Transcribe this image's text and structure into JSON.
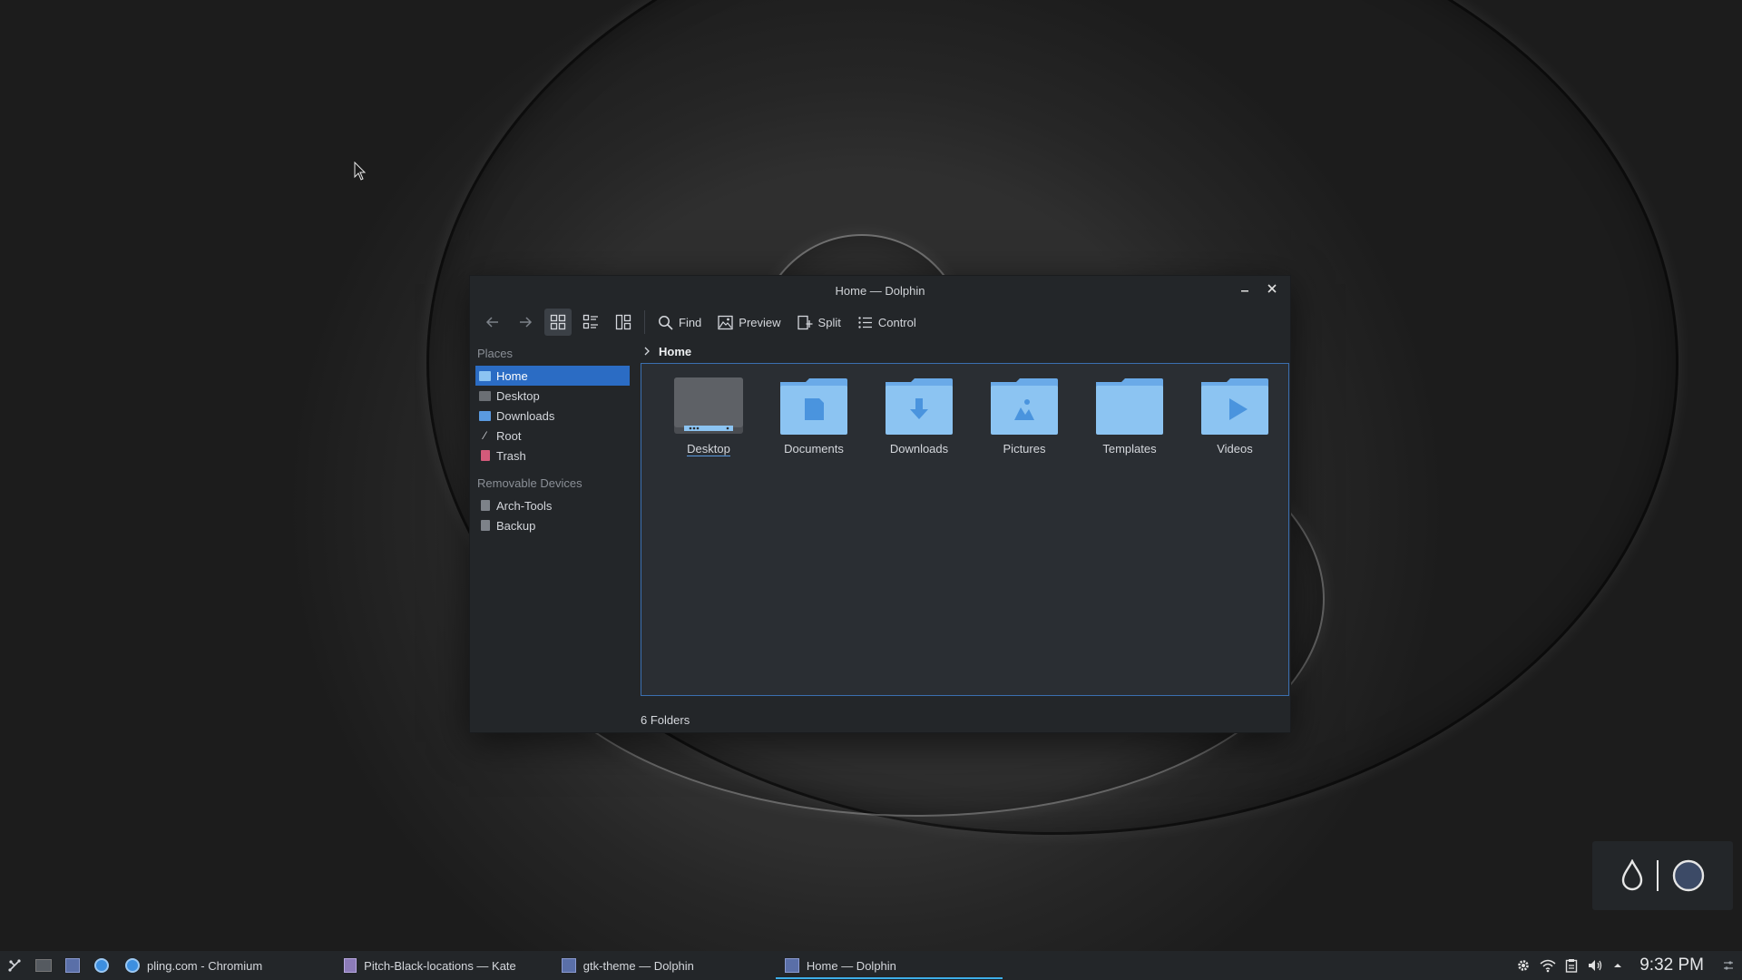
{
  "window": {
    "title": "Home — Dolphin",
    "minimize_symbol": "–",
    "close_symbol": "✕"
  },
  "toolbar": {
    "back_icon": "arrow-left-icon",
    "forward_icon": "arrow-right-icon",
    "view_modes": [
      "icons-view",
      "compact-view",
      "details-view"
    ],
    "find_label": "Find",
    "preview_label": "Preview",
    "split_label": "Split",
    "control_label": "Control"
  },
  "places": {
    "title": "Places",
    "items": [
      {
        "label": "Home",
        "icon": "home-icon",
        "color": "#5a9ae0",
        "selected": true
      },
      {
        "label": "Desktop",
        "icon": "desktop-icon",
        "color": "#8b8f94"
      },
      {
        "label": "Downloads",
        "icon": "downloads-icon",
        "color": "#5a9ae0"
      },
      {
        "label": "Root",
        "icon": "root-icon",
        "color": "#d4d7dc"
      },
      {
        "label": "Trash",
        "icon": "trash-icon",
        "color": "#d35a7a"
      }
    ]
  },
  "removable": {
    "title": "Removable Devices",
    "items": [
      {
        "label": "Arch-Tools",
        "icon": "drive-icon"
      },
      {
        "label": "Backup",
        "icon": "drive-icon"
      }
    ]
  },
  "breadcrumb": {
    "current": "Home"
  },
  "files": [
    {
      "label": "Desktop",
      "icon": "desktop-folder-icon"
    },
    {
      "label": "Documents",
      "icon": "documents-folder-icon"
    },
    {
      "label": "Downloads",
      "icon": "downloads-folder-icon"
    },
    {
      "label": "Pictures",
      "icon": "pictures-folder-icon"
    },
    {
      "label": "Templates",
      "icon": "templates-folder-icon"
    },
    {
      "label": "Videos",
      "icon": "videos-folder-icon"
    }
  ],
  "status": {
    "text": "6 Folders"
  },
  "taskbar": {
    "tasks": [
      {
        "label": "pling.com - Chromium",
        "icon": "chromium-icon"
      },
      {
        "label": "Pitch-Black-locations — Kate",
        "icon": "kate-icon"
      },
      {
        "label": "gtk-theme — Dolphin",
        "icon": "dolphin-icon"
      },
      {
        "label": "Home — Dolphin",
        "icon": "dolphin-icon",
        "active": true
      }
    ],
    "clock": "9:32 PM"
  },
  "colors": {
    "accent": "#3daee9",
    "selection": "#2b6cc4",
    "folder": "#8cc4f2"
  }
}
